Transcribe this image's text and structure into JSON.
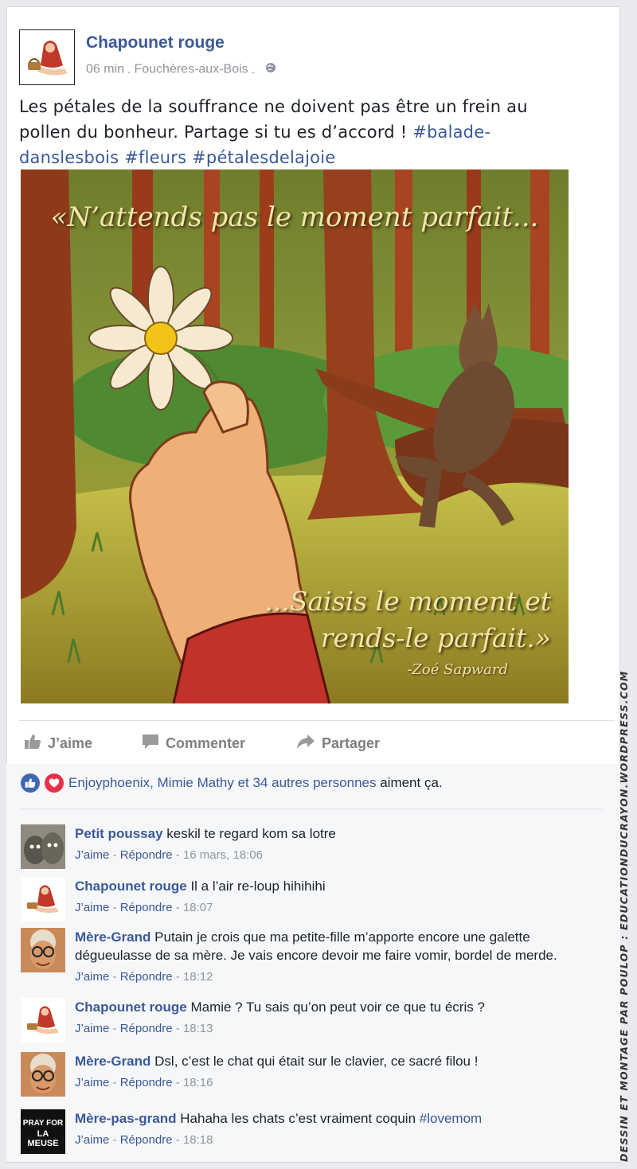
{
  "post": {
    "author": "Chapounet rouge",
    "time": "06 min",
    "location": "Fouchères-aux-Bois",
    "separator": ".",
    "text_before": "Les pétales de la souffrance ne doivent pas être un frein au pollen du bonheur. Partage si tu es d’accord ! ",
    "hashtags": [
      "#balade-danslesbois",
      "#fleurs",
      "#pétalesdelajoie"
    ],
    "image": {
      "quote_top": "«N’attends pas le moment parfait...",
      "quote_bottom_line1": "...Saisis le moment et",
      "quote_bottom_line2": "rends-le parfait.»",
      "quote_author": "-Zoé Sapward"
    }
  },
  "actions": {
    "like": "J’aime",
    "comment": "Commenter",
    "share": "Partager"
  },
  "likes": {
    "names": "Enjoyphoenix, Mimie Mathy et 34 autres personnes",
    "suffix": " aiment ça."
  },
  "comments": [
    {
      "author": "Petit poussay",
      "text": "keskil te regard kom sa lotre",
      "like": "J’aime",
      "reply": "Répondre",
      "time": "16 mars, 18:06",
      "avatar": "rock-couple-avatar"
    },
    {
      "author": "Chapounet rouge",
      "text": "Il a l’air re-loup hihihihi",
      "like": "J’aime",
      "reply": "Répondre",
      "time": "18:07",
      "avatar": "red-riding-hood-avatar"
    },
    {
      "author": "Mère-Grand",
      "text": "Putain je crois que ma petite-fille m’apporte encore une galette dégueulasse de sa mère. Je vais encore devoir me faire vomir, bordel de merde.",
      "like": "J’aime",
      "reply": "Répondre",
      "time": "18:12",
      "avatar": "grandma-avatar"
    },
    {
      "author": "Chapounet rouge",
      "text": "Mamie ? Tu sais qu’on peut voir ce que tu écris ?",
      "like": "J’aime",
      "reply": "Répondre",
      "time": "18:13",
      "avatar": "red-riding-hood-avatar"
    },
    {
      "author": "Mère-Grand",
      "text": "Dsl, c’est le chat qui était sur le clavier, ce sacré filou !",
      "like": "J’aime",
      "reply": "Répondre",
      "time": "18:16",
      "avatar": "grandma-avatar"
    },
    {
      "author": "Mère-pas-grand",
      "text": "Hahaha les chats c’est vraiment coquin ",
      "hashtag": "#lovemom",
      "like": "J’aime",
      "reply": "Répondre",
      "time": "18:18",
      "avatar": "pray-for-la-meuse-avatar",
      "avatar_text_1": "PRAY FOR",
      "avatar_text_2": "LA MEUSE"
    }
  ],
  "meta_separator": " - ",
  "credit": "DESSIN ET MONTAGE PAR POULOP : EDUCATIONDUCRAYON.WORDPRESS.COM",
  "colors": {
    "link": "#3b5998",
    "grey": "#90949c",
    "background": "#e9eaed",
    "comment_bg": "#f6f7f9"
  }
}
